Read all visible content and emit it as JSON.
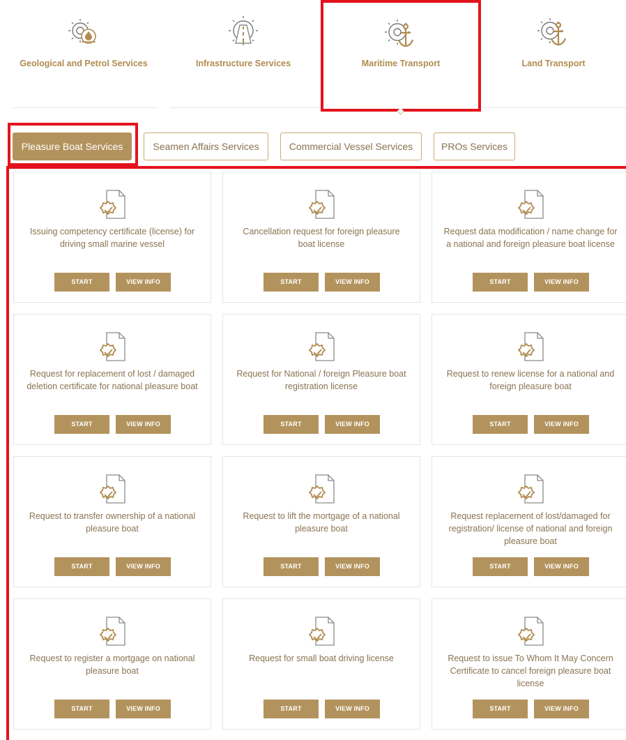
{
  "categories": [
    {
      "label": "Geological and Petrol Services",
      "icon": "gear-oil-icon"
    },
    {
      "label": "Infrastructure Services",
      "icon": "gear-road-icon"
    },
    {
      "label": "Maritime Transport",
      "icon": "gear-anchor-icon",
      "active": true
    },
    {
      "label": "Land Transport",
      "icon": "gear-anchor-icon"
    }
  ],
  "tabs": [
    {
      "label": "Pleasure Boat Services",
      "active": true
    },
    {
      "label": "Seamen Affairs Services"
    },
    {
      "label": "Commercial Vessel Services"
    },
    {
      "label": "PROs Services"
    }
  ],
  "buttons": {
    "start": "START",
    "info": "VIEW INFO"
  },
  "services": [
    {
      "title": "Issuing competency certificate (license) for driving small marine vessel"
    },
    {
      "title": "Cancellation request for foreign pleasure boat license"
    },
    {
      "title": "Request data modification / name change for a national and foreign pleasure boat license"
    },
    {
      "title": "Request for replacement of lost / damaged deletion certificate for national pleasure boat"
    },
    {
      "title": "Request for National / foreign Pleasure boat registration license"
    },
    {
      "title": "Request to renew license for a national and foreign pleasure boat"
    },
    {
      "title": "Request to transfer ownership of a national pleasure boat"
    },
    {
      "title": "Request to lift the mortgage of a national pleasure boat"
    },
    {
      "title": "Request replacement of lost/damaged for registration/ license of national and foreign pleasure boat"
    },
    {
      "title": "Request to register a mortgage on national pleasure boat"
    },
    {
      "title": "Request for small boat driving license"
    },
    {
      "title": "Request to issue To Whom It May Concern Certificate to cancel foreign pleasure boat license"
    }
  ],
  "colors": {
    "accent": "#b3935d",
    "text": "#8a7351",
    "highlight": "#e3131d"
  }
}
